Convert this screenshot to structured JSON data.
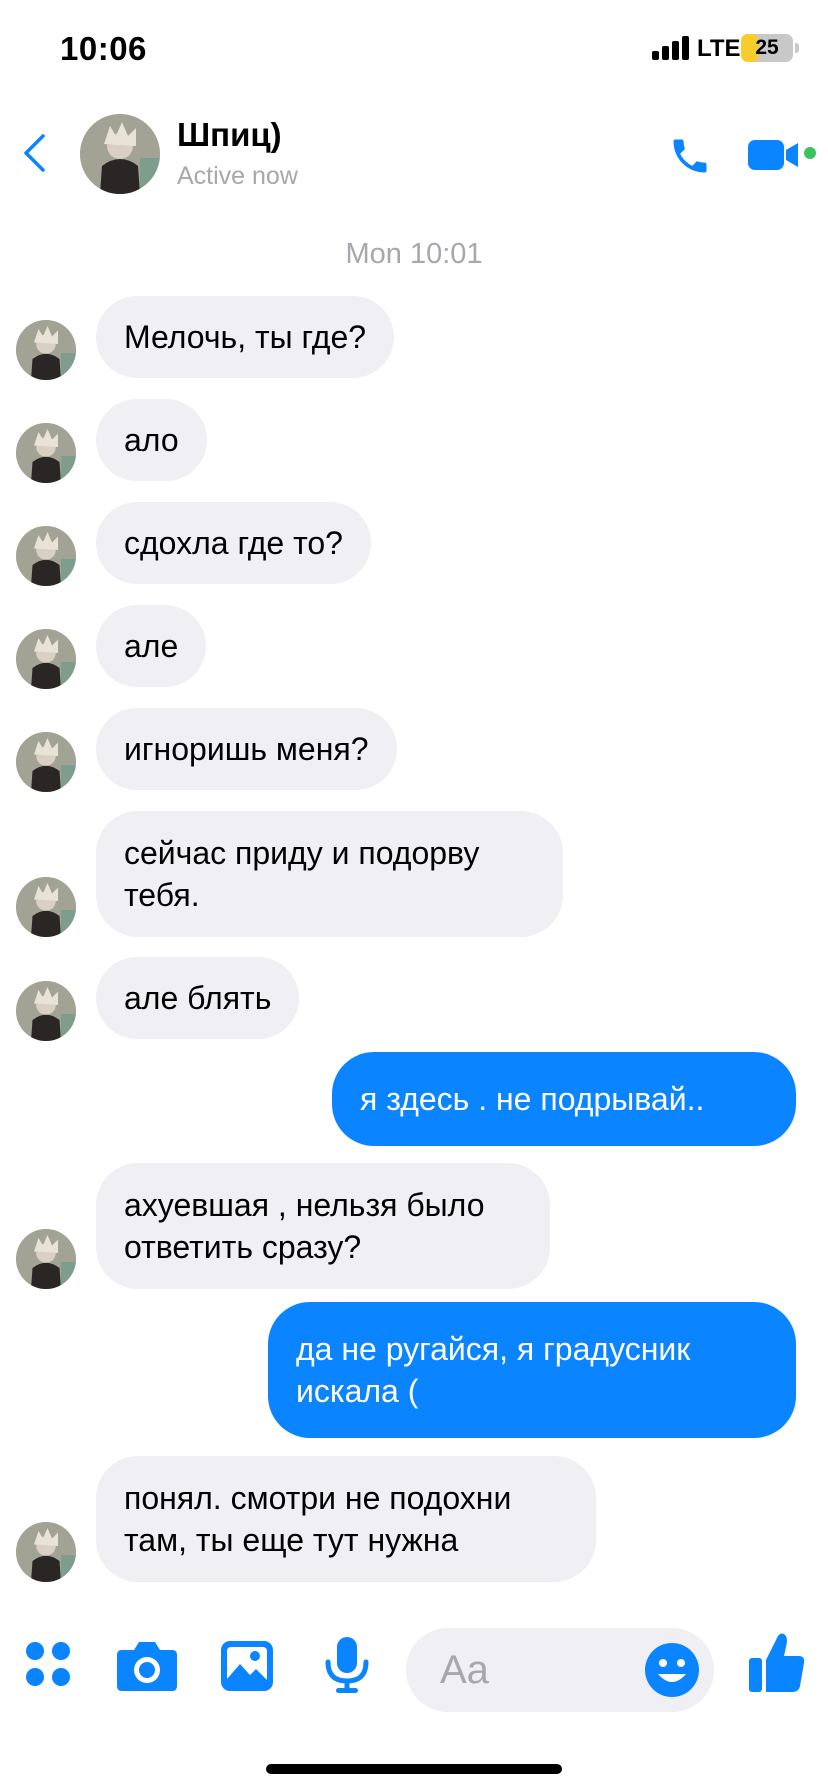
{
  "status_bar": {
    "time": "10:06",
    "network": "LTE",
    "battery_level": "25",
    "battery_percent": 25
  },
  "header": {
    "contact_name": "Шпиц)",
    "status": "Active now"
  },
  "conversation": {
    "timestamp": "Mon 10:01",
    "messages": [
      {
        "sender": "contact",
        "text": "Мелочь, ты где?"
      },
      {
        "sender": "contact",
        "text": "ало"
      },
      {
        "sender": "contact",
        "text": "сдохла где то?"
      },
      {
        "sender": "contact",
        "text": "але"
      },
      {
        "sender": "contact",
        "text": "игноришь меня?"
      },
      {
        "sender": "contact",
        "text": "сейчас приду и подорву тебя."
      },
      {
        "sender": "contact",
        "text": "але блять"
      },
      {
        "sender": "me",
        "text": "я здесь . не подрывай.."
      },
      {
        "sender": "contact",
        "text": "ахуевшая , нельзя было ответить сразу?"
      },
      {
        "sender": "me",
        "text": "да не ругайся, я градусник искала ("
      },
      {
        "sender": "contact",
        "text": "понял. смотри не подохни там, ты еще тут нужна"
      }
    ]
  },
  "composer": {
    "placeholder": "Aa"
  },
  "colors": {
    "accent": "#0a84ff",
    "received_bubble": "#f0eff4",
    "secondary_text": "#a7a7ad",
    "online": "#3ac35f"
  },
  "icons": [
    "back-chevron",
    "phone",
    "video-camera",
    "apps-grid",
    "camera",
    "photo-gallery",
    "microphone",
    "emoji",
    "thumbs-up"
  ]
}
